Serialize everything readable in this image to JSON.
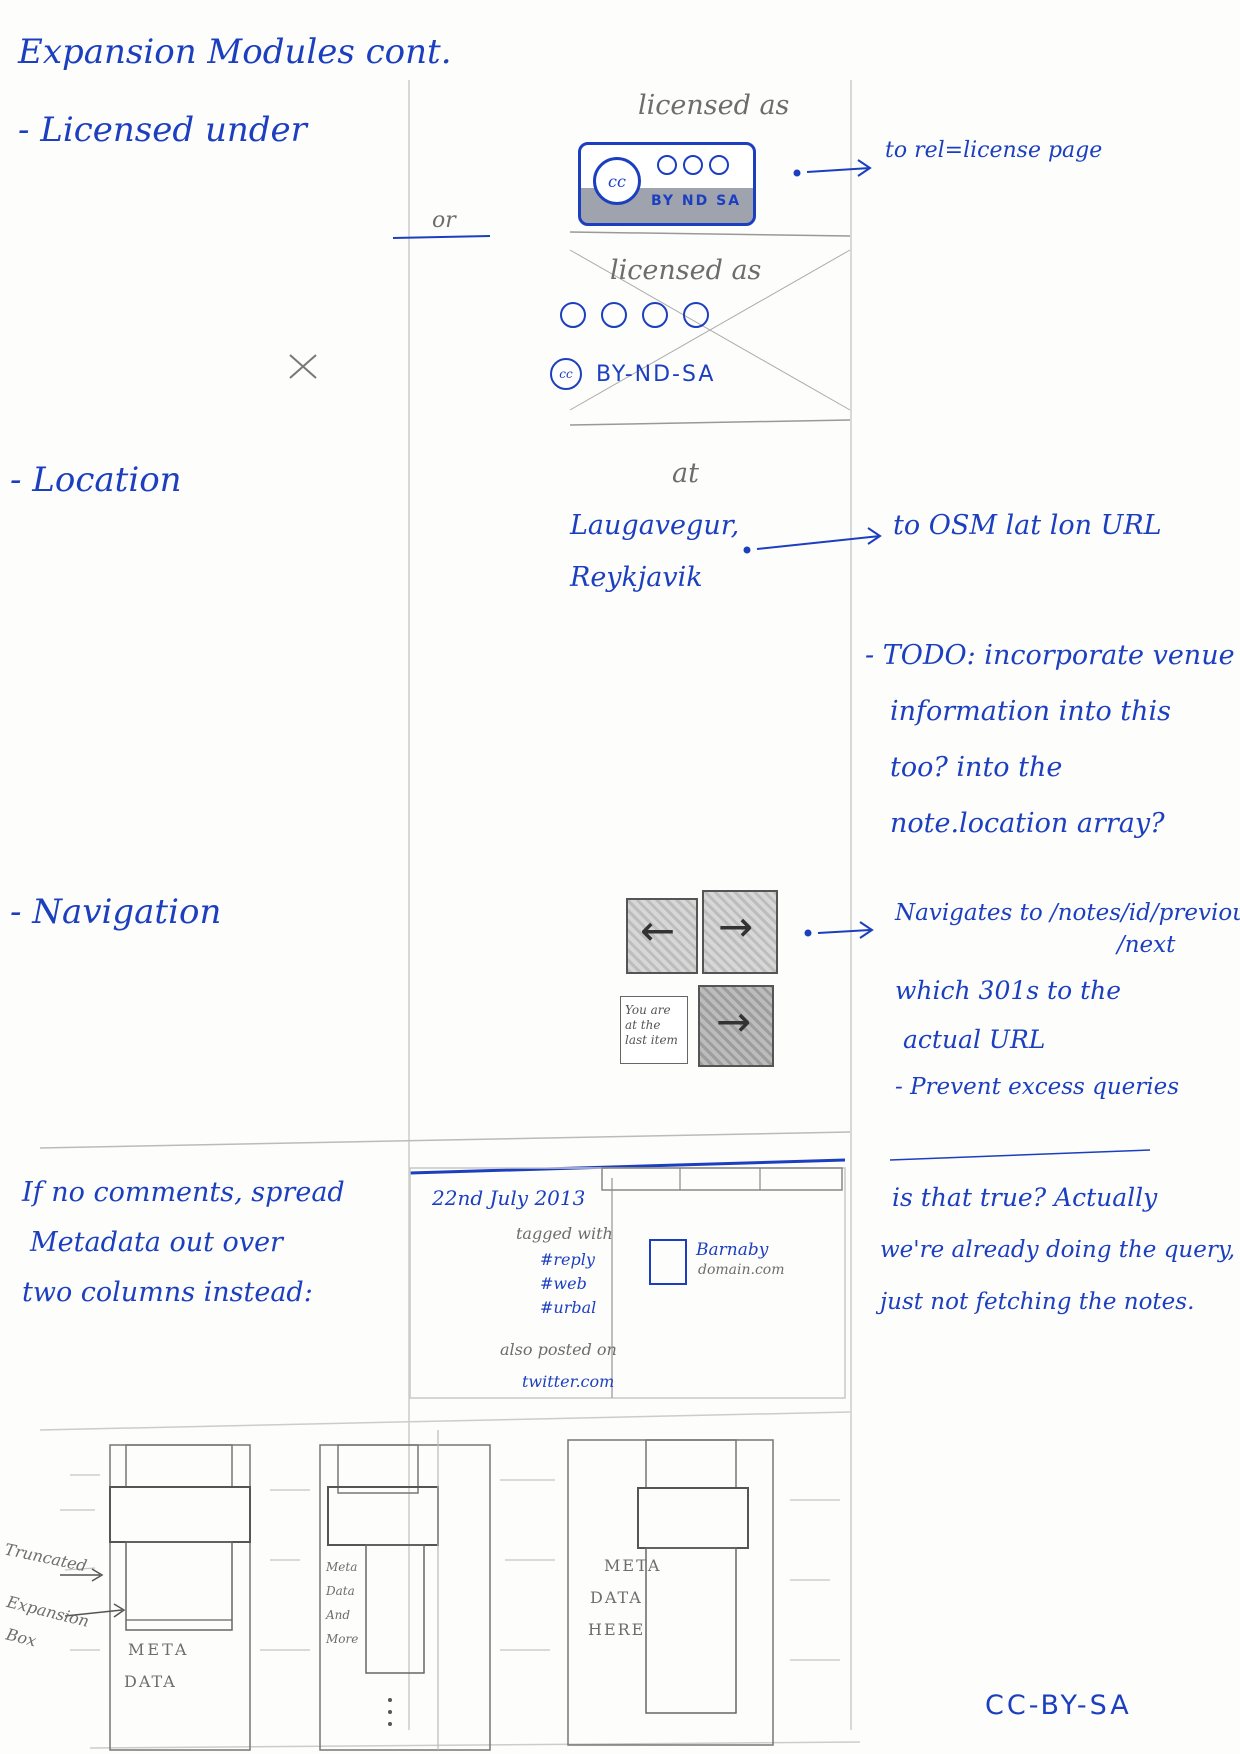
{
  "title": "Expansion Modules cont.",
  "sections": {
    "licensed": {
      "label": "- Licensed under",
      "sketch_heading": "licensed as",
      "badge_cc": "cc",
      "badge_terms": "BY ND SA",
      "note": "to rel=license page",
      "or_label": "or",
      "alt_heading": "licensed as",
      "alt_text": "BY-ND-SA",
      "cc_small": "cc"
    },
    "location": {
      "label": "- Location",
      "at_label": "at",
      "place_line1": "Laugavegur,",
      "place_line2": "Reykjavik",
      "note": "to OSM lat lon URL",
      "todo_lines": [
        "- TODO: incorporate venue",
        "information into this",
        "too? into the",
        "note.location array?"
      ]
    },
    "navigation": {
      "label": "- Navigation",
      "note_lines": [
        "Navigates to /notes/id/previous",
        "/next",
        "which 301s to the",
        "actual URL",
        "- Prevent excess queries"
      ],
      "last_item_lines": [
        "You are",
        "at the",
        "last item"
      ]
    },
    "comments": {
      "note_lines": [
        "If no comments, spread",
        "Metadata out over",
        "two columns instead:"
      ],
      "date": "22nd July 2013",
      "tagged_label": "tagged with",
      "tags": [
        "#reply",
        "#web",
        "#urbal"
      ],
      "also_posted": "also posted on",
      "posted_site": "twitter.com",
      "author_name": "Barnaby",
      "author_domain": "domain.com",
      "reply_note_lines": [
        "is that true? Actually",
        "we're already doing the query,",
        "just not fetching the notes."
      ]
    },
    "layouts": {
      "truncated_label": "Truncated",
      "expansion_label_line1": "Expansion",
      "expansion_label_line2": "Box",
      "panel1_meta": [
        "META",
        "DATA"
      ],
      "panel2_meta": [
        "Meta",
        "Data",
        "And",
        "More"
      ],
      "panel3_meta": [
        "META",
        "DATA",
        "HERE"
      ]
    }
  },
  "footer_license": "CC-BY-SA",
  "colors": {
    "ink": "#1c3fc0",
    "pencil": "#6d6d6d",
    "paper": "#fdfdfb"
  }
}
